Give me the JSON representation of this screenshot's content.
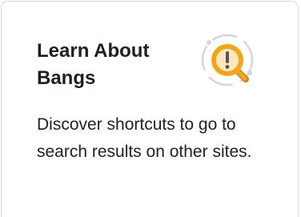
{
  "card": {
    "title": "Learn About Bangs",
    "description": "Discover shortcuts to go to search results on other sites.",
    "icon": "magnifier-alert-icon",
    "colors": {
      "accent": "#f3a51c",
      "accent_dark": "#d0851a",
      "alert_dark": "#555555",
      "ring": "#d6d6d6",
      "text": "#222222",
      "border": "#dcdcdc"
    }
  }
}
